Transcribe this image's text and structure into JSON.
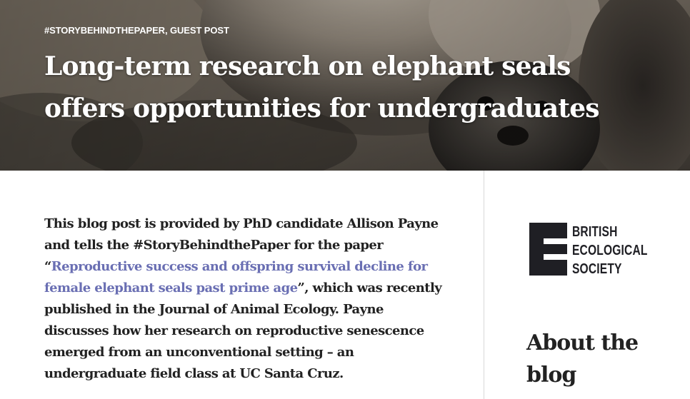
{
  "hero": {
    "tag_1": "#STORYBEHINDTHEPAPER",
    "tag_separator": ", ",
    "tag_2": "GUEST POST",
    "title": "Long-term research on elephant seals offers opportunities for undergraduates"
  },
  "post": {
    "intro_before_link": "This blog post is provided by PhD candidate Allison Payne and tells the #StoryBehindthePaper for the paper “",
    "paper_link": "Reproductive success and offspring survival decline for female elephant seals past prime age",
    "intro_after_link": "”, which was recently published in the Journal of Animal Ecology. Payne discusses how her research on reproductive senescence emerged from an unconventional setting – an undergraduate field class at UC Santa Cruz."
  },
  "sidebar": {
    "logo": {
      "icon": "bes-e-mark-icon",
      "line_1": "BRITISH",
      "line_2": "ECOLOGICAL",
      "line_3": "SOCIETY"
    },
    "about_heading": "About the blog"
  },
  "colors": {
    "link": "#6a6fb3",
    "body_text": "#222222",
    "logo": "#1f1f24",
    "divider": "#d8d8d8"
  }
}
